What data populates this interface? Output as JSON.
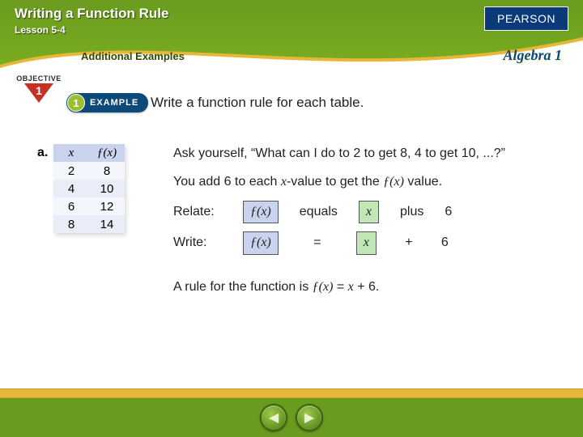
{
  "header": {
    "title": "Writing a Function Rule",
    "lesson": "Lesson 5-4",
    "additional": "Additional Examples",
    "brand": "PEARSON",
    "course": "Algebra 1"
  },
  "objective": {
    "label": "OBJECTIVE",
    "number": "1"
  },
  "example": {
    "number": "1",
    "label": "EXAMPLE",
    "prompt": "Write a function rule for each table."
  },
  "part": {
    "label": "a."
  },
  "table": {
    "head": {
      "x": "x",
      "fx": "ƒ(x)"
    },
    "rows": [
      {
        "x": "2",
        "fx": "8"
      },
      {
        "x": "4",
        "fx": "10"
      },
      {
        "x": "6",
        "fx": "12"
      },
      {
        "x": "8",
        "fx": "14"
      }
    ]
  },
  "body": {
    "ask": "Ask yourself, “What can I do to 2 to get 8, 4 to get 10, ...?”",
    "explain_pre": "You add 6 to each ",
    "explain_x": "x",
    "explain_mid": "-value to get the ",
    "explain_fx": "ƒ(x)",
    "explain_post": " value.",
    "relate_label": "Relate:",
    "relate_fx": "ƒ(x)",
    "relate_eq": "equals",
    "relate_x": "x",
    "relate_plus": "plus",
    "relate_c": "6",
    "write_label": "Write:",
    "write_fx": "ƒ(x)",
    "write_eq": "=",
    "write_x": "x",
    "write_plus": "+",
    "write_c": "6",
    "rule_pre": "A rule for the function is ",
    "rule_fx": "ƒ(x)",
    "rule_mid": " = ",
    "rule_x": "x",
    "rule_post": " + 6."
  },
  "nav": {
    "prev": "◀",
    "next": "▶"
  }
}
